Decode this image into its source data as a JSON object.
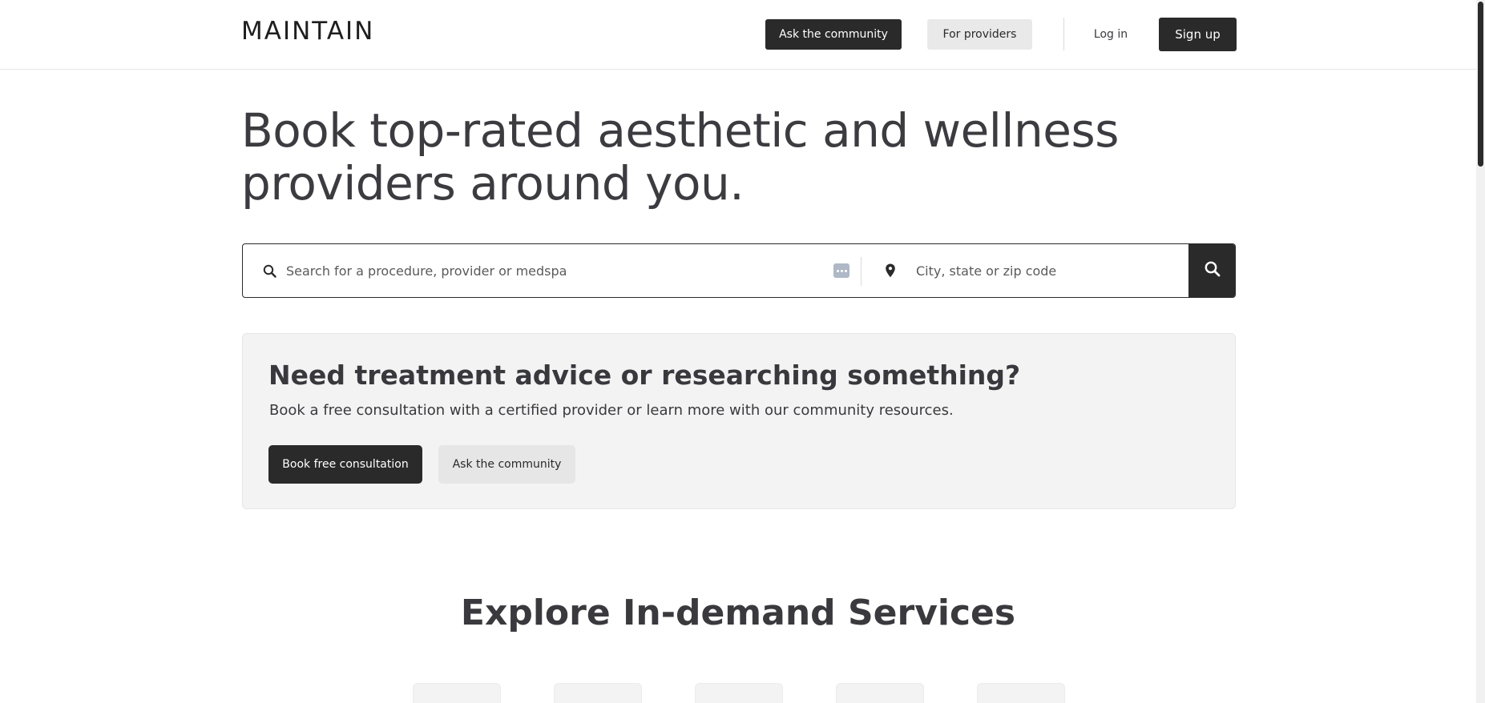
{
  "header": {
    "logo": "MAINTAIN",
    "ask_community": "Ask the community",
    "for_providers": "For providers",
    "login": "Log in",
    "signup": "Sign up"
  },
  "hero": {
    "title_line1": "Book top-rated aesthetic and wellness",
    "title_line2": "providers around you."
  },
  "search": {
    "query_placeholder": "Search for a procedure, provider or medspa",
    "location_placeholder": "City, state or zip code",
    "icons": {
      "left": "search-icon",
      "location": "map-pin-icon",
      "submit": "search-icon",
      "extension": "dots-icon"
    }
  },
  "advice": {
    "title": "Need treatment advice or researching something?",
    "subtitle": "Book a free consultation with a certified provider or learn more with our community resources.",
    "book_label": "Book free consultation",
    "ask_label": "Ask the community"
  },
  "explore": {
    "title": "Explore In-demand Services"
  },
  "colors": {
    "dark_button": "#2a2a2a",
    "light_button": "#e9e9e9",
    "card_bg": "#f3f3f3",
    "text": "#3a3a3e"
  }
}
